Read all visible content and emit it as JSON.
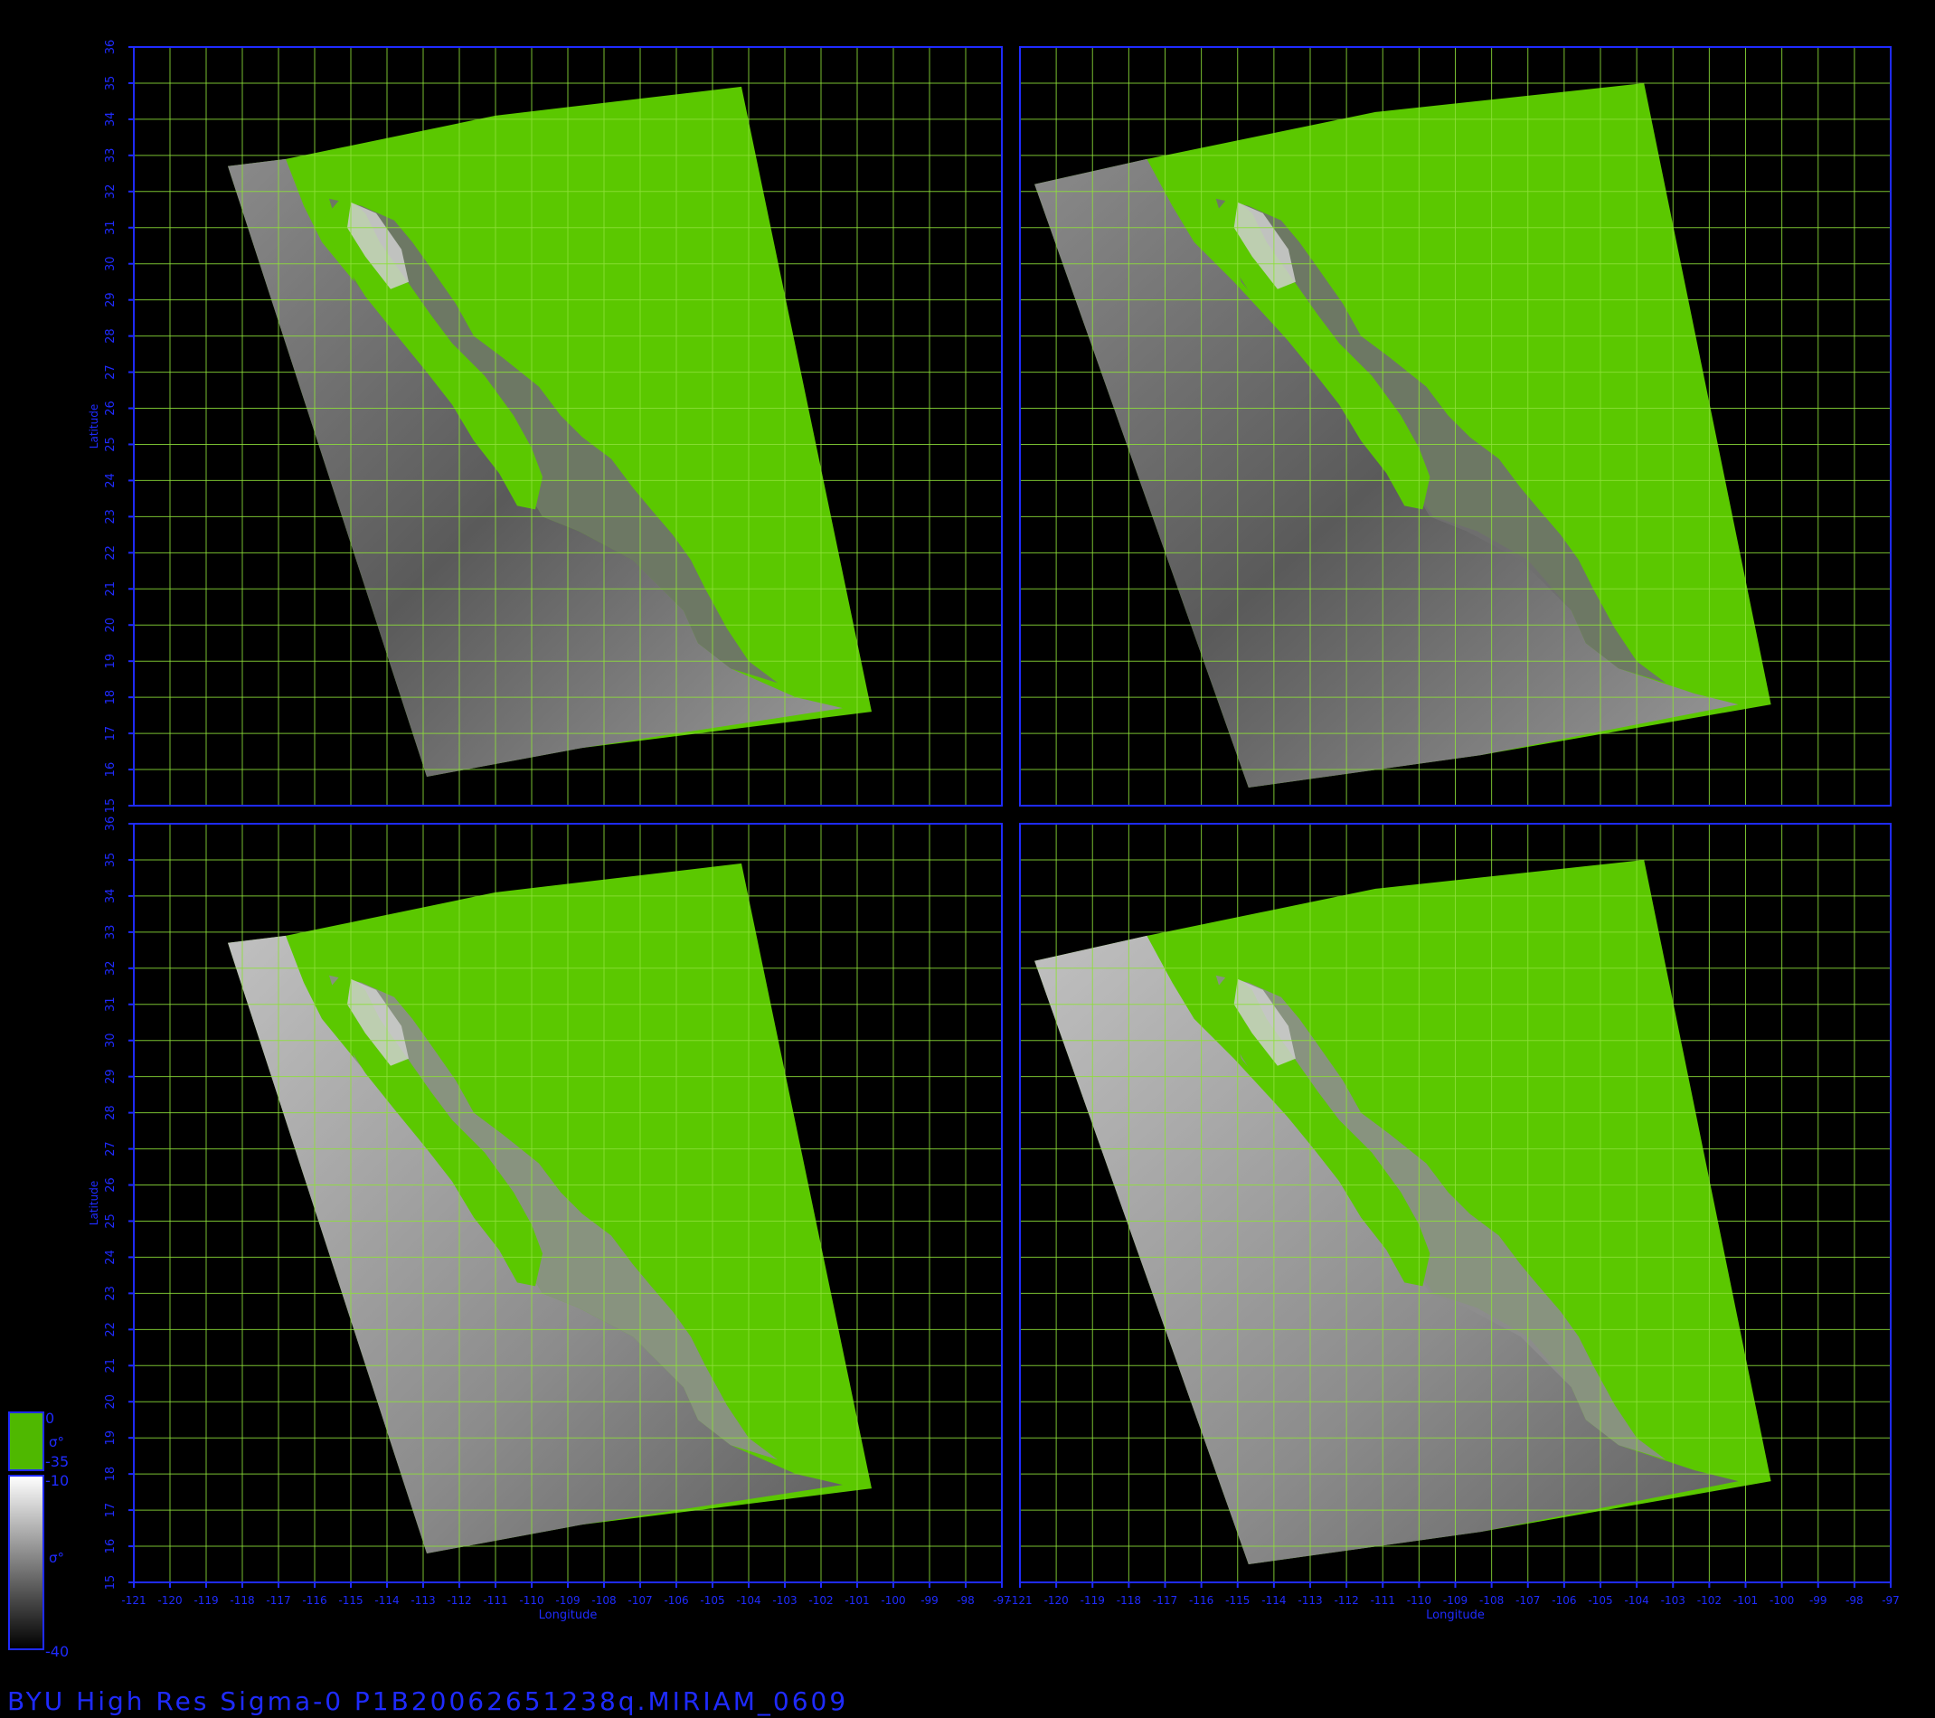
{
  "figure": {
    "footer": "BYU  High  Res  Sigma-0  P1B20062651238q.MIRIAM_0609",
    "x_axis_label": "Longitude",
    "y_axis_label": "Latitude",
    "x_ticks": [
      "-121",
      "-120",
      "-119",
      "-118",
      "-117",
      "-116",
      "-115",
      "-114",
      "-113",
      "-112",
      "-111",
      "-110",
      "-109",
      "-108",
      "-107",
      "-106",
      "-105",
      "-104",
      "-103",
      "-102",
      "-101",
      "-100",
      "-99",
      "-98",
      "-97"
    ],
    "y_ticks": [
      "15",
      "16",
      "17",
      "18",
      "19",
      "20",
      "21",
      "22",
      "23",
      "24",
      "25",
      "26",
      "27",
      "28",
      "29",
      "30",
      "31",
      "32",
      "33",
      "34",
      "35",
      "36"
    ],
    "lon_range": [
      -121,
      -97
    ],
    "lat_range": [
      15,
      36
    ],
    "colors": {
      "frame": "#1f2bff",
      "grid": "#8ee03a",
      "ocean_sigma0": "#5bc800",
      "land_sigma0_light": "#cfcfcf",
      "land_sigma0_dark": "#3c3c3c",
      "background": "#000000"
    }
  },
  "legend": {
    "green_max": "0",
    "green_symbol": "σ°",
    "green_min": "-35",
    "gray_max": "-10",
    "gray_symbol": "σ°",
    "gray_min": "-40"
  },
  "panels": [
    {
      "id": "top-left"
    },
    {
      "id": "top-right"
    },
    {
      "id": "bottom-left"
    },
    {
      "id": "bottom-right"
    }
  ]
}
